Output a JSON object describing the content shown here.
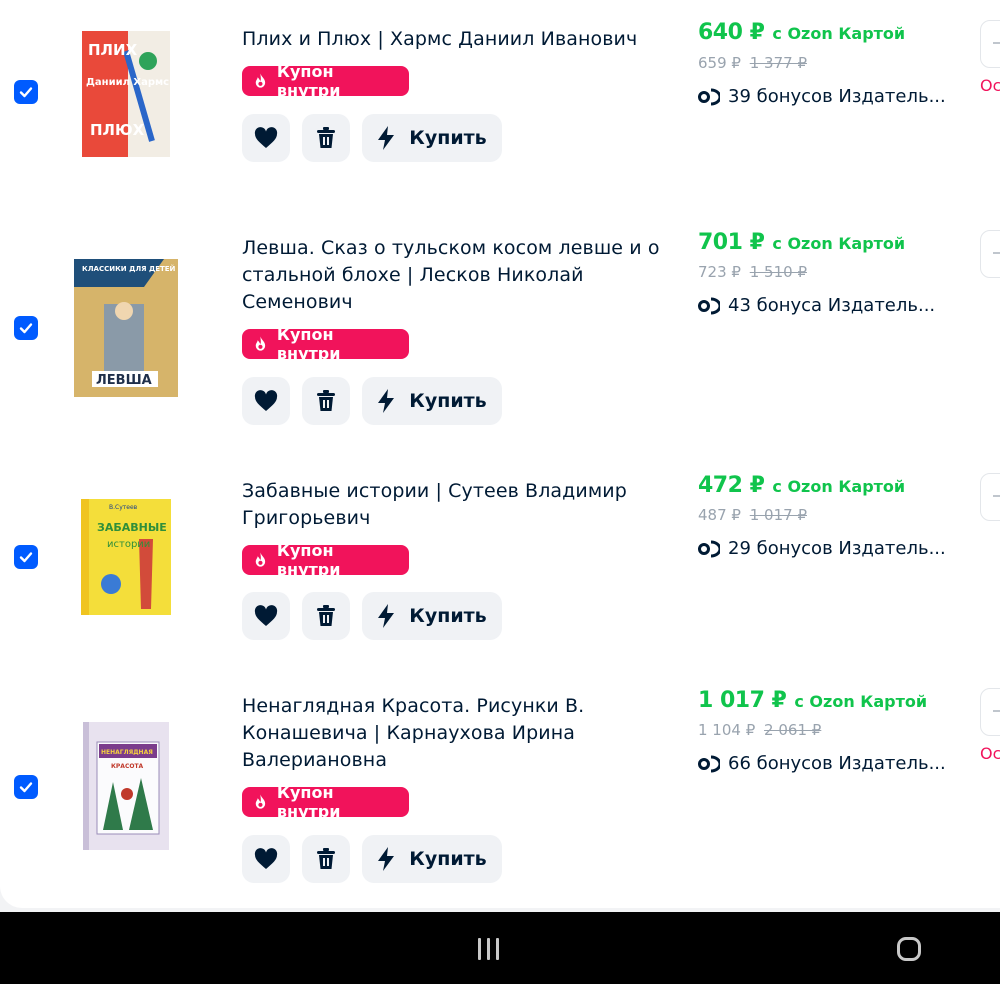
{
  "items": [
    {
      "title": "Плих и Плюх | Хармс Даниил Иванович",
      "coupon": "Купон внутри",
      "buy": "Купить",
      "price": "640 ₽",
      "card_label": "с Ozon Картой",
      "old_price": "659 ₽",
      "crossed_price": "1 377 ₽",
      "bonus": "39 бонусов Издатель...",
      "side_text": "Ос",
      "cover": {
        "top": "ПЛИХ",
        "mid": "Даниил Хармс",
        "bottom": "ПЛЮХ"
      }
    },
    {
      "title": "Левша. Сказ о тульском косом левше и о стальной блохе | Лесков Николай Семенович",
      "coupon": "Купон внутри",
      "buy": "Купить",
      "price": "701 ₽",
      "card_label": "с Ozon Картой",
      "old_price": "723 ₽",
      "crossed_price": "1 510 ₽",
      "bonus": "43 бонуса Издатель...",
      "side_text": "",
      "cover": {
        "top": "КЛАССИКИ ДЛЯ ДЕТЕЙ",
        "mid": "",
        "bottom": "ЛЕВША"
      }
    },
    {
      "title": "Забавные истории | Сутеев Владимир Григорьевич",
      "coupon": "Купон внутри",
      "buy": "Купить",
      "price": "472 ₽",
      "card_label": "с Ozon Картой",
      "old_price": "487 ₽",
      "crossed_price": "1 017 ₽",
      "bonus": "29 бонусов Издатель...",
      "side_text": "",
      "cover": {
        "top": "В.Сутеев",
        "mid": "ЗАБАВНЫЕ",
        "bottom": "истории"
      }
    },
    {
      "title": "Ненаглядная Красота. Рисунки В. Конашевича | Карнаухова Ирина Валериановна",
      "coupon": "Купон внутри",
      "buy": "Купить",
      "price": "1 017 ₽",
      "card_label": "с Ozon Картой",
      "old_price": "1 104 ₽",
      "crossed_price": "2 061 ₽",
      "bonus": "66 бонусов Издатель...",
      "side_text": "Ос",
      "cover": {
        "top": "НЕНАГЛЯДНАЯ",
        "mid": "КРАСОТА",
        "bottom": ""
      }
    }
  ],
  "icons": {
    "checkbox": "checkbox-checked-icon",
    "coupon": "flame-icon",
    "favorite": "heart-icon",
    "delete": "trash-icon",
    "buy": "lightning-icon",
    "bonus": "bonus-coin-icon",
    "nav_recent": "recent-apps-icon",
    "nav_home": "home-icon"
  },
  "colors": {
    "accent": "#005bff",
    "price_green": "#10c44c",
    "coupon_pink": "#f1135b",
    "button_bg": "#f0f2f5"
  }
}
